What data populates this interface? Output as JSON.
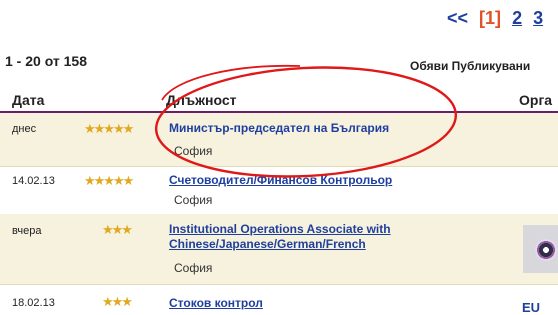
{
  "pager": {
    "prev": "<<",
    "current": "[1]",
    "pages": [
      "2",
      "3"
    ]
  },
  "results": {
    "count_text": "1 - 20 от 158",
    "published_text": "Обяви Публикувани"
  },
  "table": {
    "headers": {
      "date": "Дата",
      "position": "Длъжност",
      "organization": "Орга"
    },
    "rows": [
      {
        "date": "днес",
        "stars": 5,
        "stars_text": "★★★★★",
        "title": "Министър-председател на България",
        "city": "София",
        "highlighted": true
      },
      {
        "date": "14.02.13",
        "stars": 5,
        "stars_text": "★★★★★",
        "title": "Счетоводител/Финансов Контрольор",
        "city": "София"
      },
      {
        "date": "вчера",
        "stars": 3,
        "stars_text": "★★★",
        "title_line1": "Institutional Operations Associate with",
        "title_line2": "Chinese/Japanese/German/French",
        "city": "София"
      },
      {
        "date": "18.02.13",
        "stars": 3,
        "stars_text": "★★★",
        "title": "Стоков контрол",
        "city": ""
      }
    ]
  },
  "org_logo_text": "EU",
  "colors": {
    "link": "#1f3f9e",
    "accent": "#e0522a",
    "header_rule": "#6b1d6b",
    "annotation": "#e01818",
    "star": "#e2a820"
  },
  "icons": {
    "rating": "star-icon",
    "org_logo": "company-logo-icon"
  }
}
